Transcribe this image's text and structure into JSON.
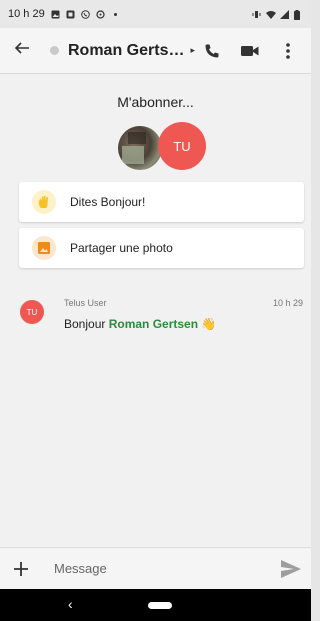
{
  "status_bar": {
    "time": "10 h 29",
    "icons": [
      "gallery-icon",
      "app-icon",
      "whatsapp-icon",
      "data-saver-icon",
      "dot-icon"
    ],
    "right_icons": [
      "vibrate-icon",
      "wifi-icon",
      "signal-icon",
      "battery-icon"
    ]
  },
  "app_bar": {
    "back_icon": "arrow-left-icon",
    "contact_name": "Roman Gerts…",
    "caret": "▸",
    "actions": [
      "phone-icon",
      "video-icon",
      "more-vert-icon"
    ]
  },
  "conversation": {
    "subscribe_title": "M'abonner...",
    "avatar_initials": "TU",
    "suggestions": [
      {
        "label": "Dites Bonjour!",
        "icon": "wave-icon",
        "icon_color": "#f6c026"
      },
      {
        "label": "Partager une photo",
        "icon": "photo-icon",
        "icon_color": "#f08a1c"
      }
    ],
    "message": {
      "avatar_initials": "TU",
      "sender": "Telus User",
      "time": "10 h 29",
      "text_prefix": "Bonjour ",
      "mention": "Roman Gertsen",
      "emoji": "👋"
    }
  },
  "composer": {
    "plus_icon": "plus-icon",
    "placeholder": "Message",
    "value": "",
    "send_icon": "send-icon"
  },
  "nav_bar": {
    "back": "‹"
  },
  "colors": {
    "avatar_red": "#ef5753",
    "mention_green": "#2e8b3e",
    "app_bar_bg": "#f5f5f5"
  }
}
